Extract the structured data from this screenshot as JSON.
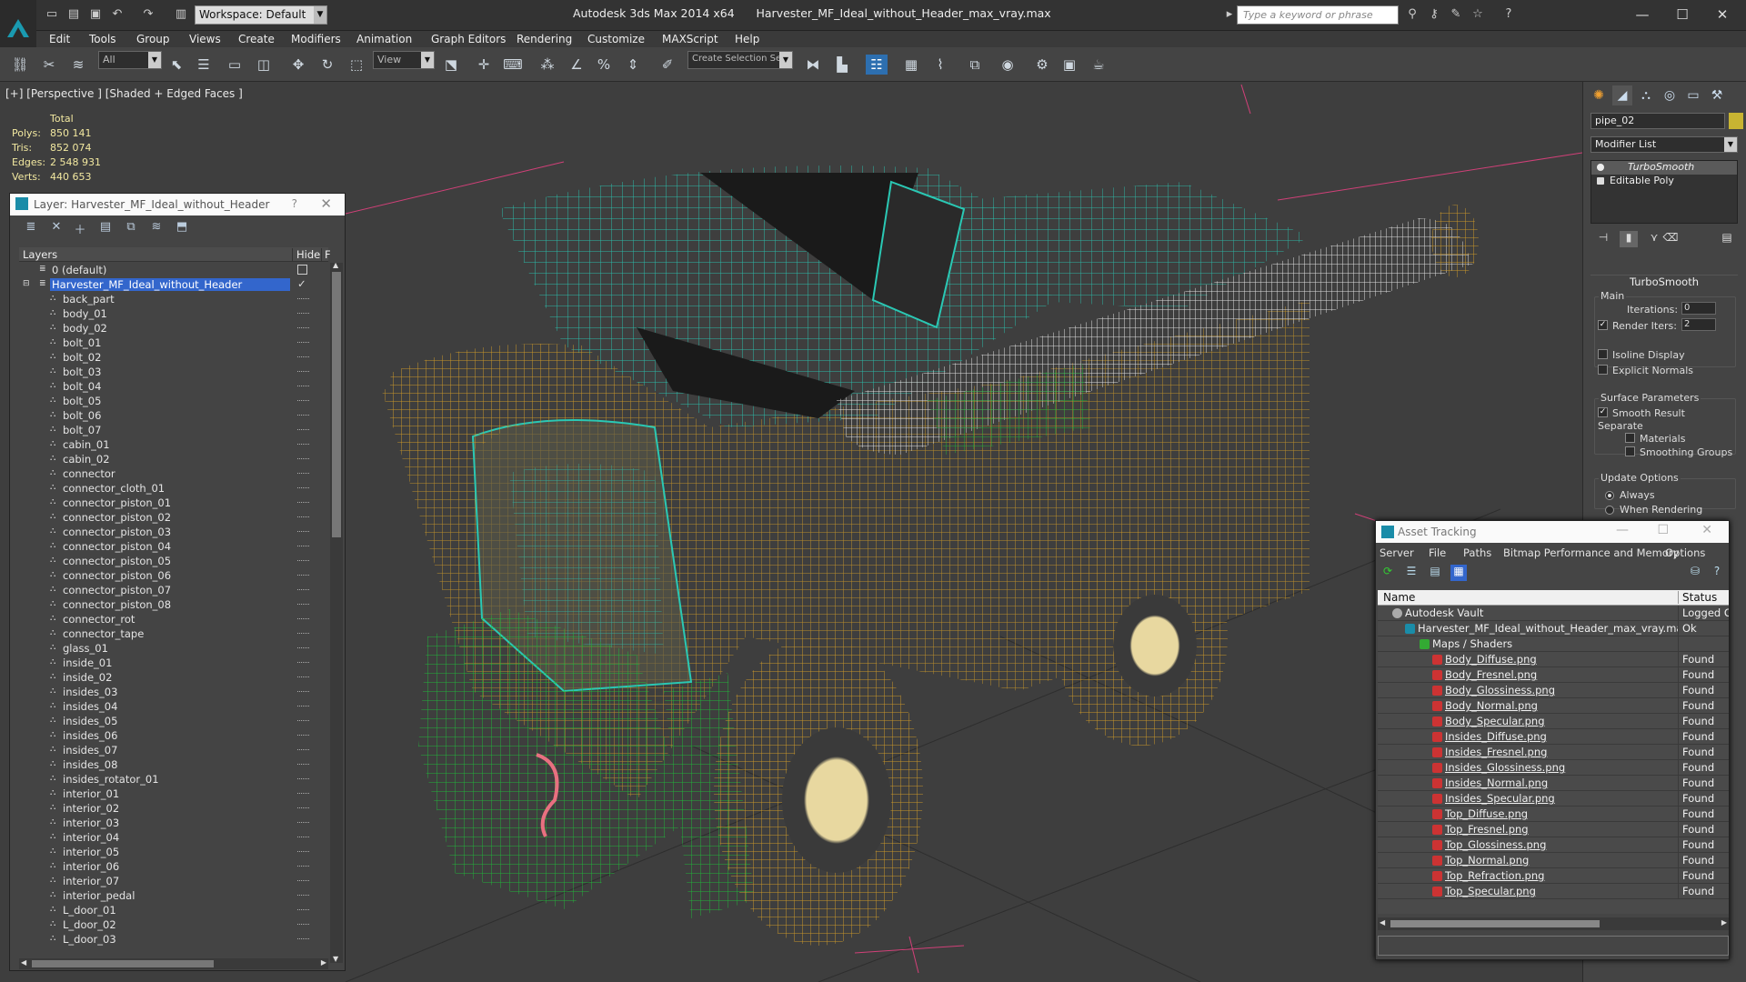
{
  "app": {
    "title": "Autodesk 3ds Max 2014 x64      Harvester_MF_Ideal_without_Header_max_vray.max",
    "workspace": "Workspace: Default",
    "search_placeholder": "Type a keyword or phrase"
  },
  "menu": [
    "Edit",
    "Tools",
    "Group",
    "Views",
    "Create",
    "Modifiers",
    "Animation",
    "Graph Editors",
    "Rendering",
    "Customize",
    "MAXScript",
    "Help"
  ],
  "toolbar": {
    "selection_filter": "All",
    "ref_coord": "View",
    "selection_set": "Create Selection Se"
  },
  "viewport": {
    "label": "[+] [Perspective ] [Shaded + Edged Faces ]",
    "stats": {
      "header": "Total",
      "rows": [
        {
          "k": "Polys:",
          "v": "850 141"
        },
        {
          "k": "Tris:",
          "v": "852 074"
        },
        {
          "k": "Edges:",
          "v": "2 548 931"
        },
        {
          "k": "Verts:",
          "v": "440 653"
        }
      ]
    }
  },
  "layer_panel": {
    "title": "Layer: Harvester_MF_Ideal_without_Header",
    "help": "?",
    "col_layers": "Layers",
    "col_hide": "Hide",
    "col_f": "F",
    "default_layer": "0 (default)",
    "active_layer": "Harvester_MF_Ideal_without_Header",
    "objects": [
      "back_part",
      "body_01",
      "body_02",
      "bolt_01",
      "bolt_02",
      "bolt_03",
      "bolt_04",
      "bolt_05",
      "bolt_06",
      "bolt_07",
      "cabin_01",
      "cabin_02",
      "connector",
      "connector_cloth_01",
      "connector_piston_01",
      "connector_piston_02",
      "connector_piston_03",
      "connector_piston_04",
      "connector_piston_05",
      "connector_piston_06",
      "connector_piston_07",
      "connector_piston_08",
      "connector_rot",
      "connector_tape",
      "glass_01",
      "inside_01",
      "inside_02",
      "insides_03",
      "insides_04",
      "insides_05",
      "insides_06",
      "insides_07",
      "insides_08",
      "insides_rotator_01",
      "interior_01",
      "interior_02",
      "interior_03",
      "interior_04",
      "interior_05",
      "interior_06",
      "interior_07",
      "interior_pedal",
      "L_door_01",
      "L_door_02",
      "L_door_03"
    ]
  },
  "command_panel": {
    "object_name": "pipe_02",
    "modifier_list": "Modifier List",
    "stack": [
      "TurboSmooth",
      "Editable Poly"
    ],
    "rollout_title": "TurboSmooth",
    "main_group": "Main",
    "iterations_label": "Iterations:",
    "iterations_value": "0",
    "render_iters_label": "Render Iters:",
    "render_iters_value": "2",
    "isoline_display": "Isoline Display",
    "explicit_normals": "Explicit Normals",
    "surface_params": "Surface Parameters",
    "smooth_result": "Smooth Result",
    "separate": "Separate",
    "materials": "Materials",
    "smoothing_groups": "Smoothing Groups",
    "update_options": "Update Options",
    "always": "Always",
    "when_rendering": "When Rendering"
  },
  "asset_tracking": {
    "title": "Asset Tracking",
    "menu": [
      "Server",
      "File",
      "Paths",
      "Bitmap Performance and Memory",
      "Options"
    ],
    "col_name": "Name",
    "col_status": "Status",
    "vault": {
      "name": "Autodesk Vault",
      "status": "Logged Ou"
    },
    "file": {
      "name": "Harvester_MF_Ideal_without_Header_max_vray.max",
      "status": "Ok"
    },
    "group": "Maps / Shaders",
    "maps": [
      {
        "name": "Body_Diffuse.png",
        "status": "Found"
      },
      {
        "name": "Body_Fresnel.png",
        "status": "Found"
      },
      {
        "name": "Body_Glossiness.png",
        "status": "Found"
      },
      {
        "name": "Body_Normal.png",
        "status": "Found"
      },
      {
        "name": "Body_Specular.png",
        "status": "Found"
      },
      {
        "name": "Insides_Diffuse.png",
        "status": "Found"
      },
      {
        "name": "Insides_Fresnel.png",
        "status": "Found"
      },
      {
        "name": "Insides_Glossiness.png",
        "status": "Found"
      },
      {
        "name": "Insides_Normal.png",
        "status": "Found"
      },
      {
        "name": "Insides_Specular.png",
        "status": "Found"
      },
      {
        "name": "Top_Diffuse.png",
        "status": "Found"
      },
      {
        "name": "Top_Fresnel.png",
        "status": "Found"
      },
      {
        "name": "Top_Glossiness.png",
        "status": "Found"
      },
      {
        "name": "Top_Normal.png",
        "status": "Found"
      },
      {
        "name": "Top_Refraction.png",
        "status": "Found"
      },
      {
        "name": "Top_Specular.png",
        "status": "Found"
      }
    ]
  },
  "colors": {
    "wire_yellow": "#c8962a",
    "wire_cyan": "#2ac8b4",
    "wire_green": "#1fbf3a",
    "selection_blue": "#3366cc"
  }
}
